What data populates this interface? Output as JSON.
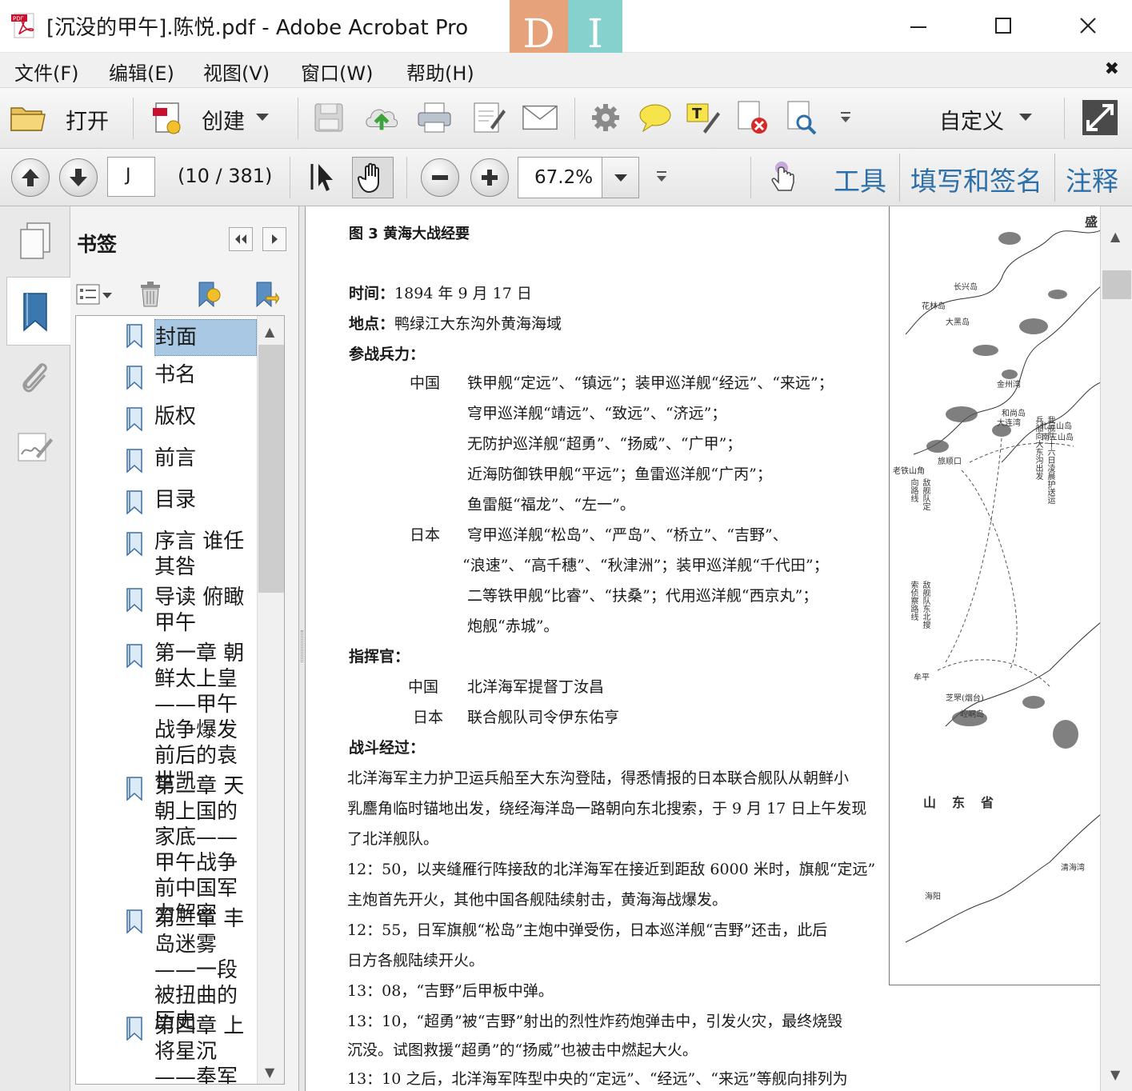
{
  "window": {
    "title": "[沉没的甲午].陈悦.pdf - Adobe Acrobat Pro",
    "brand_letters": [
      "D",
      "I"
    ],
    "controls": {
      "minimize": "minimize",
      "maximize": "maximize",
      "close": "close"
    }
  },
  "menu": {
    "items": [
      "文件(F)",
      "编辑(E)",
      "视图(V)",
      "窗口(W)",
      "帮助(H)"
    ],
    "close_glyph": "✖"
  },
  "toolbar": {
    "open_label": "打开",
    "create_label": "创建",
    "customize_label": "自定义",
    "icons": [
      "folder-icon",
      "create-pdf-icon",
      "save-icon",
      "cloud-upload-icon",
      "print-icon",
      "edit-icon",
      "mail-icon",
      "gear-icon",
      "comment-icon",
      "highlight-icon",
      "delete-page-icon",
      "search-doc-icon",
      "more-icon",
      "expand-icon"
    ]
  },
  "navbar": {
    "page_value": "J",
    "page_count": "(10 / 381)",
    "zoom_value": "67.2%",
    "links": [
      "工具",
      "填写和签名",
      "注释"
    ]
  },
  "bookmarks": {
    "title": "书签",
    "items": [
      {
        "label": "封面",
        "selected": true
      },
      {
        "label": "书名",
        "selected": false
      },
      {
        "label": "版权",
        "selected": false
      },
      {
        "label": "前言",
        "selected": false
      },
      {
        "label": "目录",
        "selected": false
      },
      {
        "label": "序言 谁任其咎",
        "selected": false
      },
      {
        "label": "导读 俯瞰甲午",
        "selected": false
      },
      {
        "label": "第一章 朝鲜太上皇——甲午战争爆发前后的袁世凯",
        "selected": false
      },
      {
        "label": "第二章 天朝上国的家底——甲午战争前中国军力解密",
        "selected": false
      },
      {
        "label": "第三章 丰岛迷雾——一段被扭曲的历史",
        "selected": false
      },
      {
        "label": "第四章 上将星沉——奉军将领左",
        "selected": false
      }
    ]
  },
  "document": {
    "heading": "图 3  黄海大战经要",
    "time_label": "时间：",
    "time_value": "1894 年 9 月 17 日",
    "place_label": "地点：",
    "place_value": "鸭绿江大东沟外黄海海域",
    "forces_label": "参战兵力：",
    "china_label": "中国",
    "china_lines": [
      "铁甲舰“定远”、“镇远”；装甲巡洋舰“经远”、“来远”；",
      "穹甲巡洋舰“靖远”、“致远”、“济远”；",
      "无防护巡洋舰“超勇”、“扬威”、“广甲”；",
      "近海防御铁甲舰“平远”；鱼雷巡洋舰“广丙”；",
      "鱼雷艇“福龙”、“左一”。"
    ],
    "japan_label": "日本",
    "japan_lines": [
      "穹甲巡洋舰“松岛”、“严岛”、“桥立”、“吉野”、",
      "“浪速”、“高千穗”、“秋津洲”；装甲巡洋舰“千代田”；",
      "二等铁甲舰“比睿”、“扶桑”；代用巡洋舰“西京丸”；",
      "炮舰“赤城”。"
    ],
    "commander_label": "指挥官：",
    "commander_china_label": "中国",
    "commander_china_value": "北洋海军提督丁汝昌",
    "commander_japan_label": "日本",
    "commander_japan_value": "联合舰队司令伊东佑亨",
    "process_label": "战斗经过：",
    "body_lines": [
      "北洋海军主力护卫运兵船至大东沟登陆，得悉情报的日本联合舰队从朝鲜小",
      "乳麢角临时锚地出发，绕经海洋岛一路朝向东北搜索，于 9 月 17 日上午发现",
      "了北洋舰队。",
      "12：50，以夹缝雁行阵接敌的北洋海军在接近到距敌 6000 米时，旗舰“定远”",
      "主炮首先开火，其他中国各舰陆续射击，黄海海战爆发。",
      "12：55，日军旗舰“松岛”主炮中弹受伤，日本巡洋舰“吉野”还击，此后",
      "日方各舰陆续开火。",
      "13：08，“吉野”后甲板中弹。",
      "13：10，“超勇”被“吉野”射出的烈性炸药炮弹击中，引发火灾，最终烧毁",
      "沉没。试图救援“超勇”的“扬威”也被击中燃起大火。",
      "13：10 之后，北洋海军阵型中央的“定远”、“经远”、“来远”等舰向排列为"
    ]
  },
  "map": {
    "top_label": "盛",
    "province": "山　东　省",
    "place_labels": [
      "长兴岛",
      "花林岛",
      "大黑岛",
      "金州湾",
      "和尚岛",
      "大连湾",
      "北三山岛",
      "南三山岛",
      "旅顺口",
      "老铁山角",
      "芝罘(烟台)",
      "崆峒岛",
      "牟平",
      "清海湾",
      "海阳"
    ],
    "vertical_labels": [
      "我舰队十六日凌晨护送运兵船向大东沟出发",
      "敌舰队定向路线",
      "敌舰队东北搜索侦察路线"
    ]
  }
}
